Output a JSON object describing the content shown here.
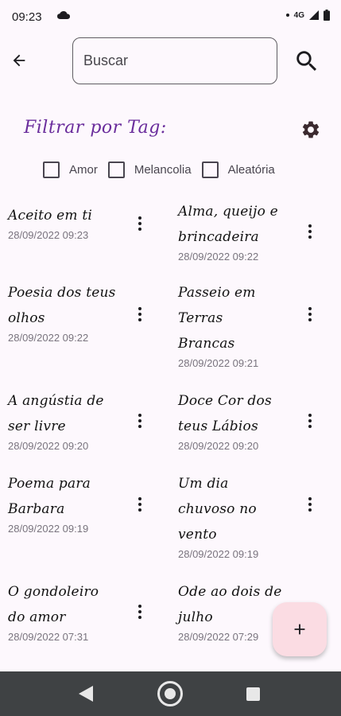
{
  "status_bar": {
    "time": "09:23",
    "network": "4G"
  },
  "search": {
    "placeholder": "Buscar",
    "value": ""
  },
  "filter": {
    "title": "Filtrar por Tag:",
    "tags": [
      {
        "label": "Amor",
        "checked": false
      },
      {
        "label": "Melancolia",
        "checked": false
      },
      {
        "label": "Aleatória",
        "checked": false
      }
    ]
  },
  "poems": [
    {
      "title": "Aceito em ti",
      "date": "28/09/2022 09:23"
    },
    {
      "title": "Alma, queijo e brincadeira",
      "date": "28/09/2022 09:22"
    },
    {
      "title": "Poesia dos teus olhos",
      "date": "28/09/2022 09:22"
    },
    {
      "title": "Passeio em Terras Brancas",
      "date": "28/09/2022 09:21"
    },
    {
      "title": "A angústia de ser livre",
      "date": "28/09/2022 09:20"
    },
    {
      "title": "Doce Cor dos teus Lábios",
      "date": "28/09/2022 09:20"
    },
    {
      "title": "Poema para Barbara",
      "date": "28/09/2022 09:19"
    },
    {
      "title": "Um dia chuvoso no vento",
      "date": "28/09/2022 09:19"
    },
    {
      "title": "O gondoleiro do amor",
      "date": "28/09/2022 07:31"
    },
    {
      "title": "Ode ao dois de julho",
      "date": "28/09/2022 07:29"
    }
  ],
  "colors": {
    "accent": "#6a2d9c",
    "background": "#fdf8fd",
    "fab": "#fbdce3",
    "nav_bar": "#3f4244"
  },
  "icons": {
    "back": "arrow-left-icon",
    "search": "search-icon",
    "settings": "gear-icon",
    "more": "more-vertical-icon",
    "add": "plus-icon"
  }
}
